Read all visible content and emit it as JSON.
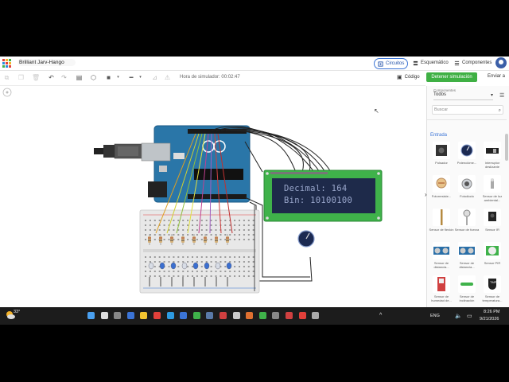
{
  "app": {
    "project_name": "Brilliant Jarv-Hango",
    "tabs": [
      {
        "label": "Circuitos",
        "active": true,
        "icon": "circuit-icon"
      },
      {
        "label": "Esquemático",
        "active": false,
        "icon": "schematic-icon"
      },
      {
        "label": "Componentes",
        "active": false,
        "icon": "components-list-icon"
      }
    ]
  },
  "toolbar": {
    "sim_time": "Hora de simulador: 00:02:47",
    "code_label": "Código",
    "stop_label": "Detener simulación",
    "send_label": "Enviar a"
  },
  "lcd": {
    "line1": "Decimal: 164",
    "line2": "Bin: 10100100"
  },
  "panel": {
    "components_label": "Componentes",
    "filter_value": "Todos",
    "search_placeholder": "Buscar",
    "section": "Entrada",
    "items": [
      {
        "name": "Pulsador",
        "icon": "pushbutton-icon"
      },
      {
        "name": "Potencióme...",
        "icon": "potentiometer-icon"
      },
      {
        "name": "Interruptor deslizante",
        "icon": "slide-switch-icon"
      },
      {
        "name": "Fotorresiste...",
        "icon": "photoresistor-icon"
      },
      {
        "name": "Fotodiodo",
        "icon": "photodiode-icon"
      },
      {
        "name": "Sensor de luz ambiental...",
        "icon": "ambient-light-icon"
      },
      {
        "name": "Sensor de flexión",
        "icon": "flex-sensor-icon"
      },
      {
        "name": "Sensor de fuerza",
        "icon": "force-sensor-icon"
      },
      {
        "name": "Sensor IR",
        "icon": "ir-sensor-icon"
      },
      {
        "name": "Sensor de distancia...",
        "icon": "ultrasonic-icon"
      },
      {
        "name": "Sensor de distancia...",
        "icon": "ultrasonic-icon-2"
      },
      {
        "name": "Sensor PIR",
        "icon": "pir-sensor-icon"
      },
      {
        "name": "Sensor de humedad de...",
        "icon": "soil-moisture-icon"
      },
      {
        "name": "Sensor de inclinación",
        "icon": "tilt-sensor-icon"
      },
      {
        "name": "Sensor de temperatura...",
        "icon": "temperature-sensor-icon"
      }
    ]
  },
  "taskbar": {
    "weather": "33°",
    "language": "ENG",
    "time": "8:26 PM",
    "date": "9/21/2026"
  },
  "colors": {
    "accent": "#3b74d6",
    "stop": "#3fb044",
    "lcd_bg": "#1e2a4a",
    "lcd_text": "#9aa7cc",
    "pcb": "#2a76a8",
    "lcd_pcb": "#3fb24a"
  }
}
